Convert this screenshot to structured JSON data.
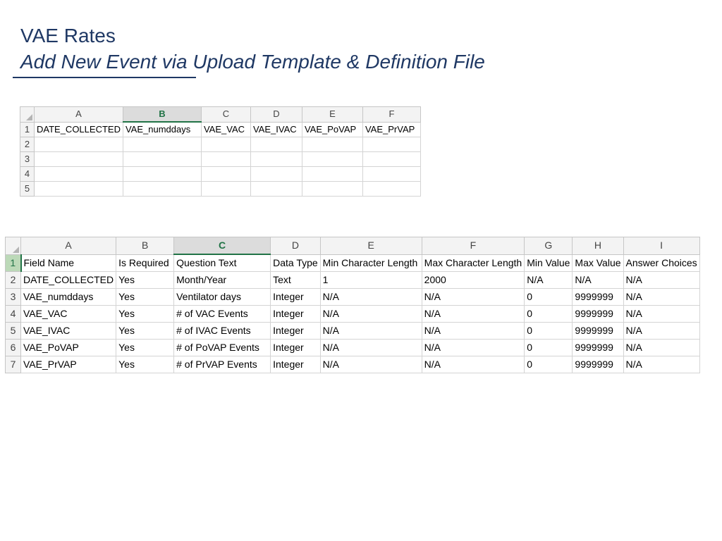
{
  "slide": {
    "title": "VAE Rates",
    "subtitle": "Add New Event via Upload Template & Definition File"
  },
  "template_sheet": {
    "columns": [
      "A",
      "B",
      "C",
      "D",
      "E",
      "F"
    ],
    "selected_column": "B",
    "rows": [
      {
        "num": "1",
        "cells": [
          "DATE_COLLECTED",
          "VAE_numddays",
          "VAE_VAC",
          "VAE_IVAC",
          "VAE_PoVAP",
          "VAE_PrVAP"
        ]
      },
      {
        "num": "2",
        "cells": [
          "",
          "",
          "",
          "",
          "",
          ""
        ]
      },
      {
        "num": "3",
        "cells": [
          "",
          "",
          "",
          "",
          "",
          ""
        ]
      },
      {
        "num": "4",
        "cells": [
          "",
          "",
          "",
          "",
          "",
          ""
        ]
      },
      {
        "num": "5",
        "cells": [
          "",
          "",
          "",
          "",
          "",
          ""
        ]
      }
    ]
  },
  "definition_sheet": {
    "columns": [
      "A",
      "B",
      "C",
      "D",
      "E",
      "F",
      "G",
      "H",
      "I"
    ],
    "selected_column": "C",
    "selected_row": "1",
    "rows": [
      {
        "num": "1",
        "cells": [
          "Field Name",
          "Is Required",
          "Question Text",
          "Data Type",
          "Min Character Length",
          "Max Character Length",
          "Min Value",
          "Max Value",
          "Answer Choices"
        ]
      },
      {
        "num": "2",
        "cells": [
          "DATE_COLLECTED",
          "Yes",
          "Month/Year",
          "Text",
          "1",
          "2000",
          "N/A",
          "N/A",
          "N/A"
        ]
      },
      {
        "num": "3",
        "cells": [
          "VAE_numddays",
          "Yes",
          "Ventilator days",
          "Integer",
          "N/A",
          "N/A",
          "0",
          "9999999",
          "N/A"
        ]
      },
      {
        "num": "4",
        "cells": [
          "VAE_VAC",
          "Yes",
          "# of VAC Events",
          "Integer",
          "N/A",
          "N/A",
          "0",
          "9999999",
          "N/A"
        ]
      },
      {
        "num": "5",
        "cells": [
          "VAE_IVAC",
          "Yes",
          "# of IVAC Events",
          "Integer",
          "N/A",
          "N/A",
          "0",
          "9999999",
          "N/A"
        ]
      },
      {
        "num": "6",
        "cells": [
          "VAE_PoVAP",
          "Yes",
          "# of PoVAP Events",
          "Integer",
          "N/A",
          "N/A",
          "0",
          "9999999",
          "N/A"
        ]
      },
      {
        "num": "7",
        "cells": [
          "VAE_PrVAP",
          "Yes",
          "# of PrVAP Events",
          "Integer",
          "N/A",
          "N/A",
          "0",
          "9999999",
          "N/A"
        ]
      }
    ]
  },
  "colors": {
    "title": "#1f3864",
    "excel_selection": "#217346"
  }
}
